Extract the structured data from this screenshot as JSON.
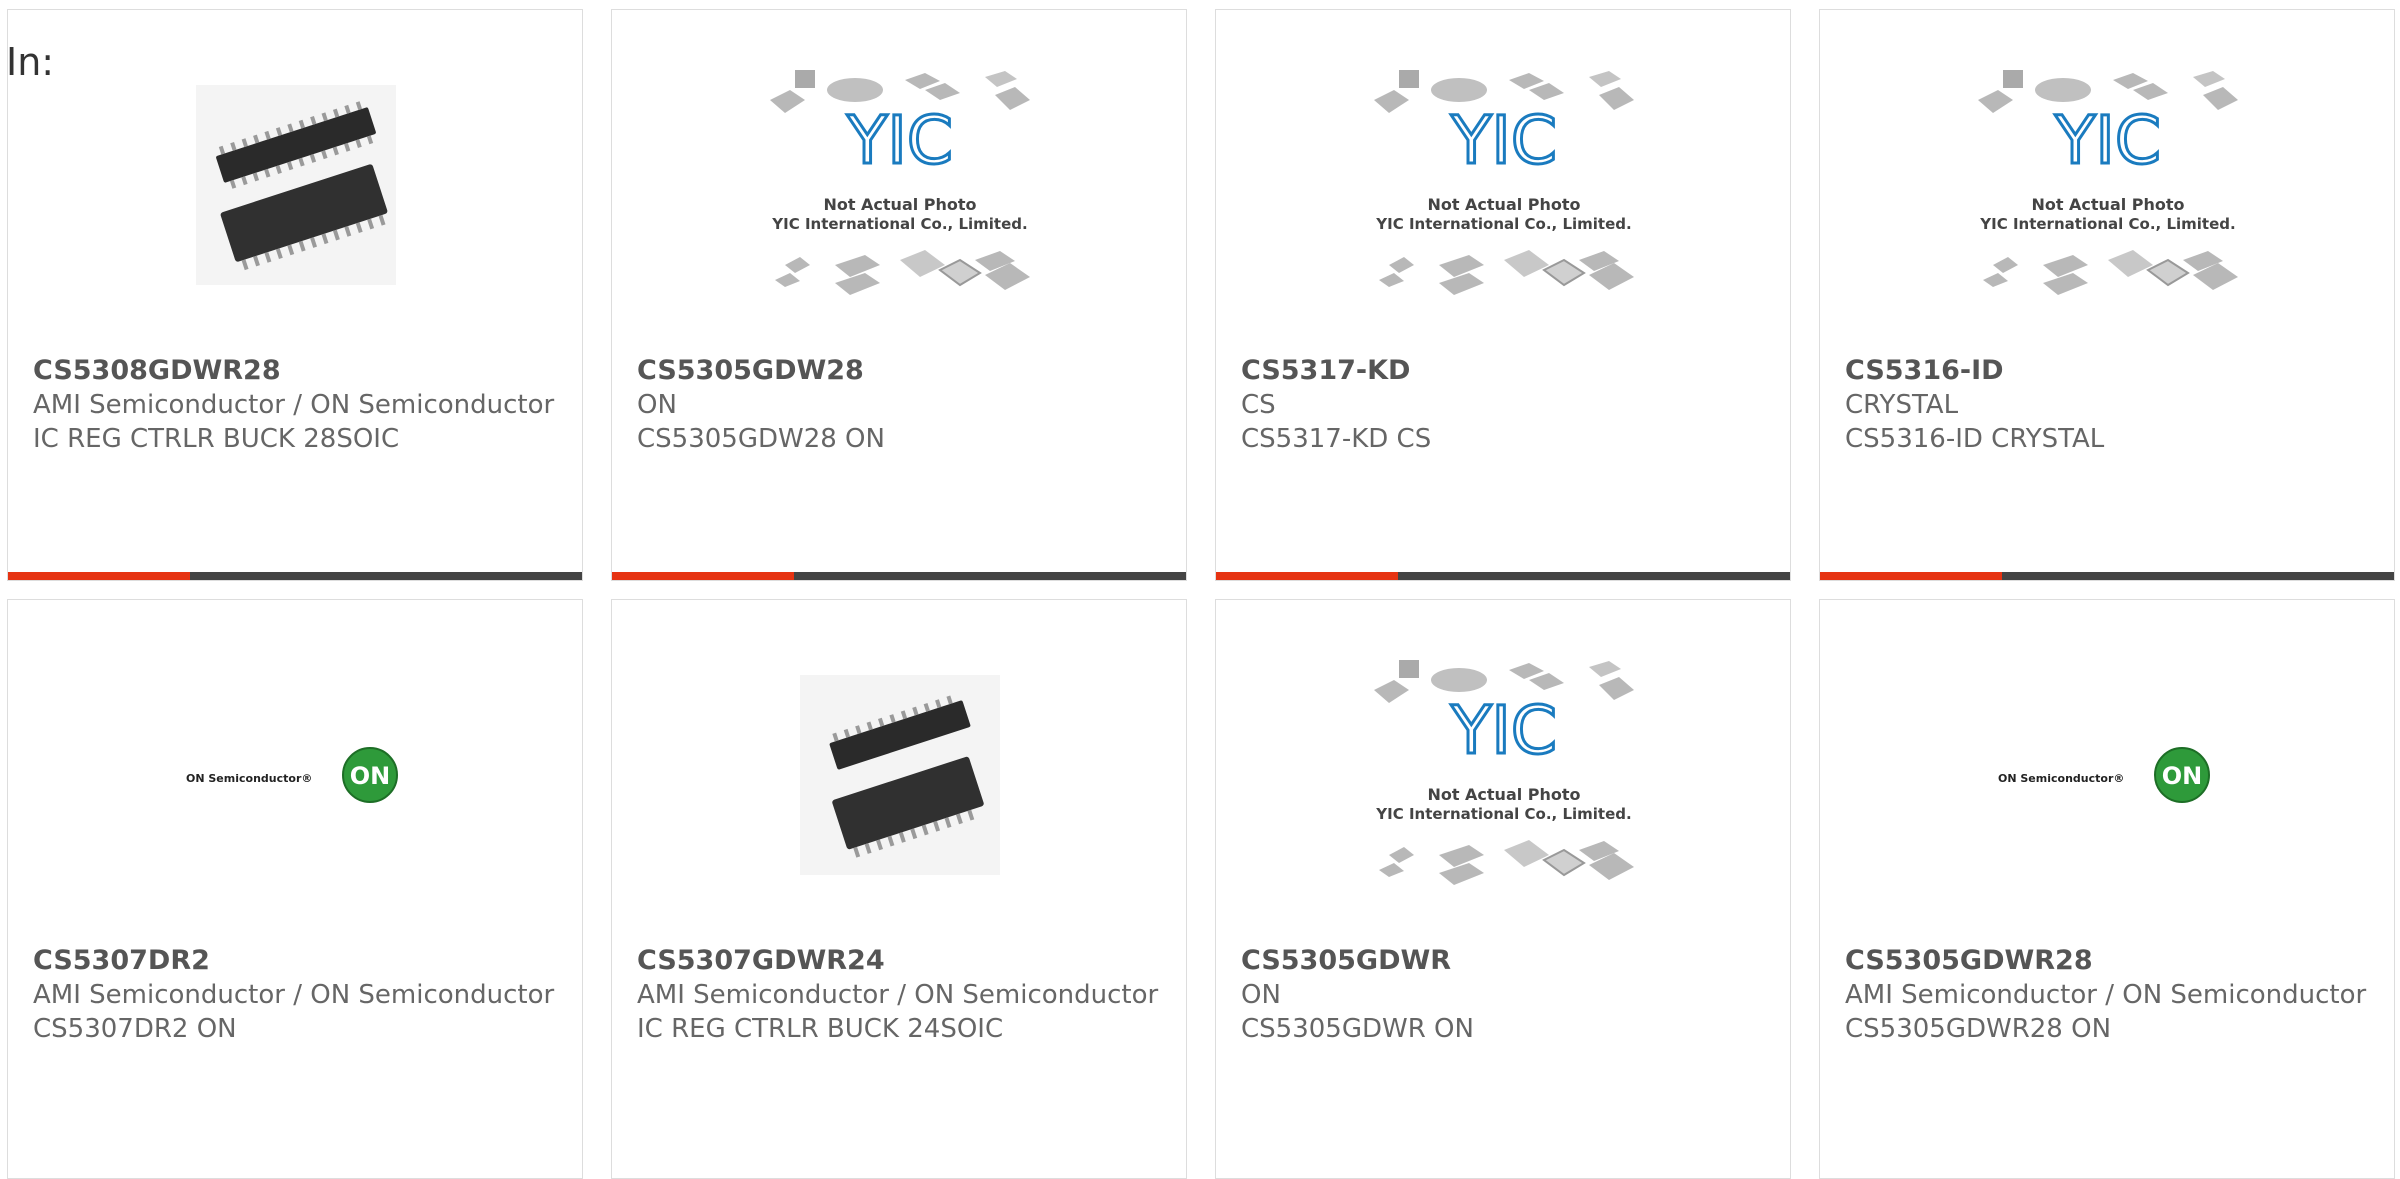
{
  "filter": {
    "label": "In:"
  },
  "products": [
    {
      "part": "CS5308GDWR28",
      "manufacturer": "AMI Semiconductor / ON Semiconductor",
      "description": "IC REG CTRLR BUCK 28SOIC",
      "image": "soic-chip-photo"
    },
    {
      "part": "CS5305GDW28",
      "manufacturer": "ON",
      "description": "CS5305GDW28 ON",
      "image": "yic-placeholder"
    },
    {
      "part": "CS5317-KD",
      "manufacturer": "CS",
      "description": "CS5317-KD CS",
      "image": "yic-placeholder"
    },
    {
      "part": "CS5316-ID",
      "manufacturer": "CRYSTAL",
      "description": "CS5316-ID CRYSTAL",
      "image": "yic-placeholder"
    },
    {
      "part": "CS5307DR2",
      "manufacturer": "AMI Semiconductor / ON Semiconductor",
      "description": "CS5307DR2 ON",
      "image": "on-semi-logo"
    },
    {
      "part": "CS5307GDWR24",
      "manufacturer": "AMI Semiconductor / ON Semiconductor",
      "description": "IC REG CTRLR BUCK 24SOIC",
      "image": "soic-chip-photo"
    },
    {
      "part": "CS5305GDWR",
      "manufacturer": "ON",
      "description": "CS5305GDWR ON",
      "image": "yic-placeholder"
    },
    {
      "part": "CS5305GDWR28",
      "manufacturer": "AMI Semiconductor / ON Semiconductor",
      "description": "CS5305GDWR28 ON",
      "image": "on-semi-logo"
    }
  ],
  "placeholder": {
    "line1": "Not Actual Photo",
    "line2": "YIC International Co., Limited.",
    "logo": "YIC"
  },
  "onlogo": {
    "text": "ON Semiconductor®",
    "badge": "ON"
  },
  "colors": {
    "accent": "#e63312",
    "bar": "#444444",
    "yic_blue": "#1a7bbf",
    "on_green": "#2e9a3a"
  }
}
